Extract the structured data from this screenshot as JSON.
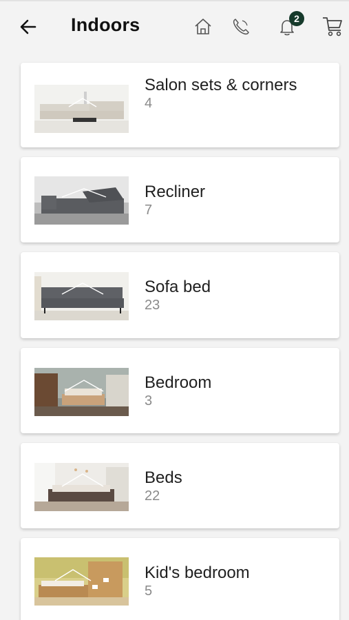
{
  "header": {
    "title": "Indoors",
    "notification_count": "2",
    "icons": [
      "back-arrow-icon",
      "home-icon",
      "phone-icon",
      "bell-icon",
      "cart-icon"
    ]
  },
  "categories": [
    {
      "name": "Salon sets & corners",
      "count": "4",
      "image": "salon-corner-sofa-photo"
    },
    {
      "name": "Recliner",
      "count": "7",
      "image": "recliner-sofa-photo"
    },
    {
      "name": "Sofa bed",
      "count": "23",
      "image": "sofa-bed-photo"
    },
    {
      "name": "Bedroom",
      "count": "3",
      "image": "bedroom-set-photo"
    },
    {
      "name": "Beds",
      "count": "22",
      "image": "bed-photo"
    },
    {
      "name": "Kid's bedroom",
      "count": "5",
      "image": "kids-bedroom-photo"
    }
  ],
  "colors": {
    "badge": "#163a2b",
    "background": "#f3f3f3",
    "card": "#ffffff",
    "count_text": "#8a8a8a"
  }
}
